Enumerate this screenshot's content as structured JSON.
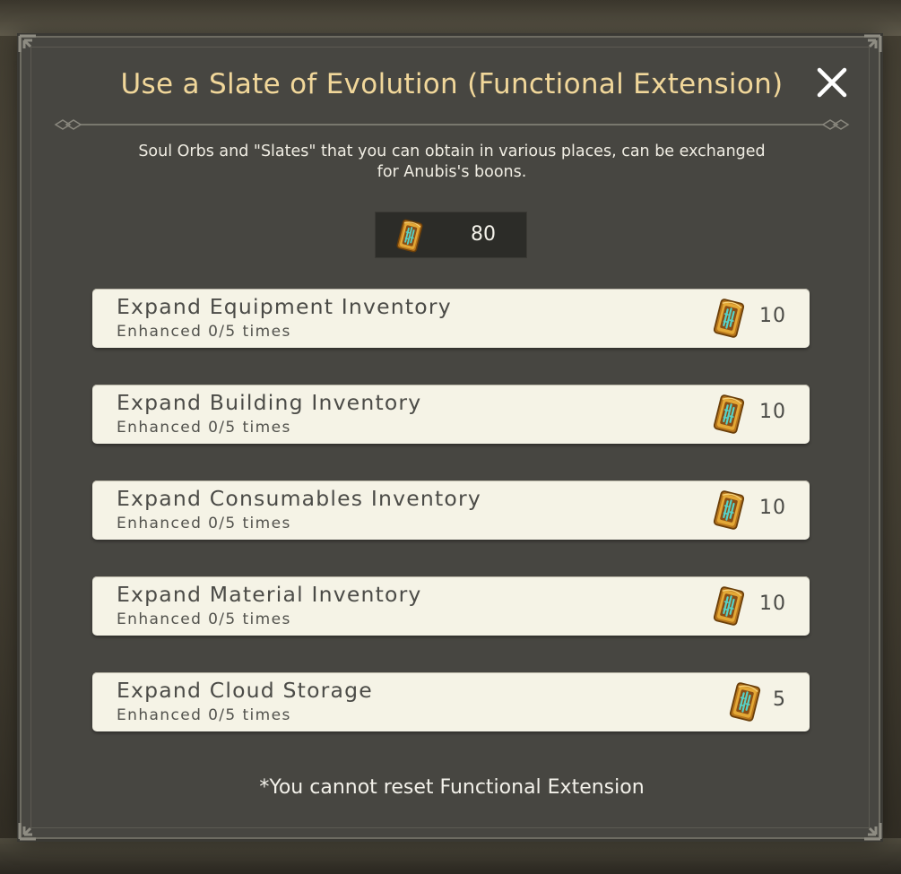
{
  "dialog": {
    "title": "Use a Slate of Evolution (Functional Extension)",
    "description_line1": "Soul Orbs and \"Slates\" that you can obtain in various places, can be exchanged",
    "description_line2": "for Anubis's boons.",
    "balance": {
      "icon": "slate-of-evolution-icon",
      "value": "80"
    },
    "close_icon": "close-icon",
    "items": [
      {
        "title": "Expand Equipment Inventory",
        "progress": "Enhanced 0/5 times",
        "cost": "10",
        "icon": "slate-of-evolution-icon"
      },
      {
        "title": "Expand Building Inventory",
        "progress": "Enhanced 0/5 times",
        "cost": "10",
        "icon": "slate-of-evolution-icon"
      },
      {
        "title": "Expand Consumables Inventory",
        "progress": "Enhanced 0/5 times",
        "cost": "10",
        "icon": "slate-of-evolution-icon"
      },
      {
        "title": "Expand Material Inventory",
        "progress": "Enhanced 0/5 times",
        "cost": "10",
        "icon": "slate-of-evolution-icon"
      },
      {
        "title": "Expand Cloud Storage",
        "progress": "Enhanced 0/5 times",
        "cost": "5",
        "icon": "slate-of-evolution-icon"
      }
    ],
    "footnote": "*You cannot reset Functional Extension"
  },
  "colors": {
    "title": "#f1d79a",
    "panel": "#474641",
    "item_background": "#f5f3e6",
    "item_text": "#4b4b47"
  }
}
